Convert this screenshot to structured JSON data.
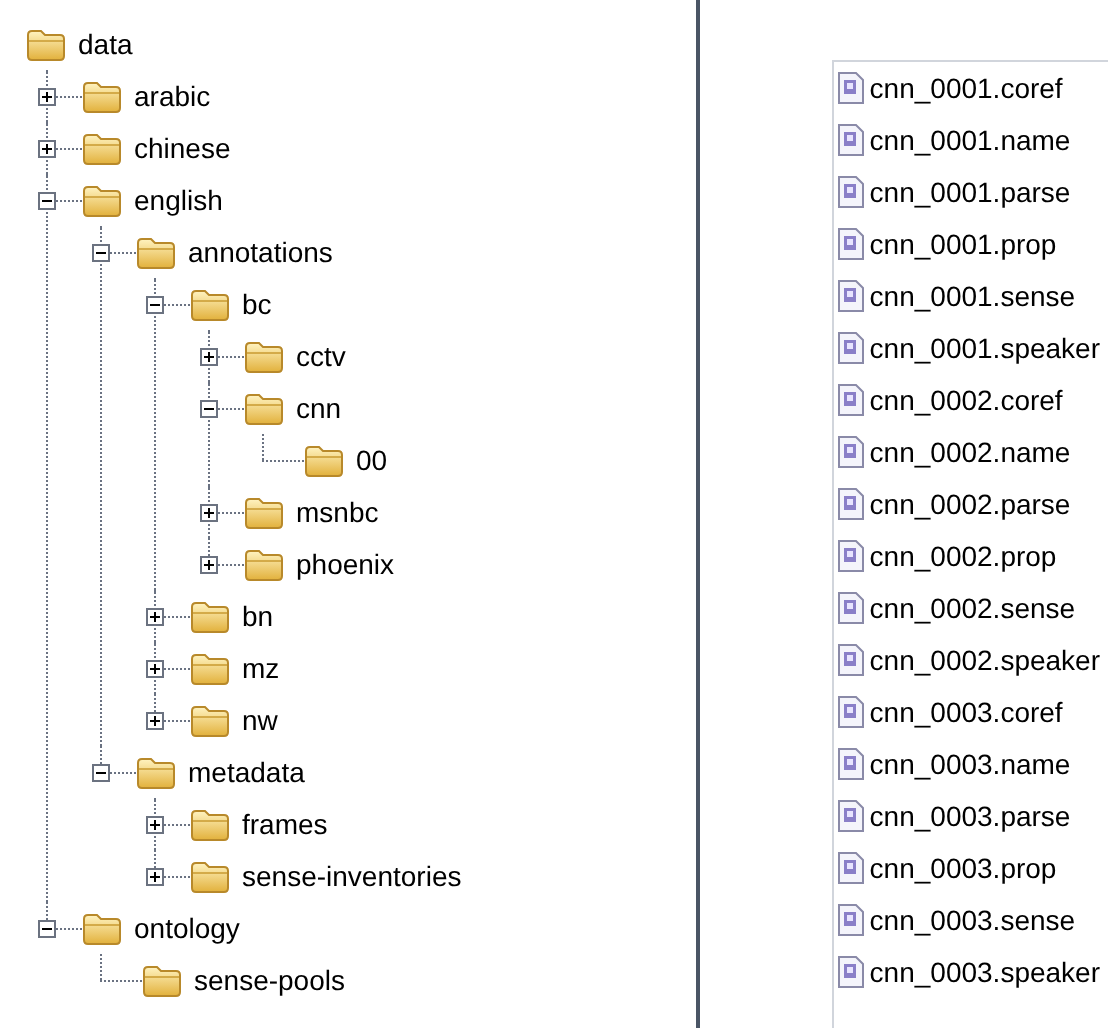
{
  "tree": {
    "label": "data",
    "children": [
      {
        "label": "arabic",
        "expanded": false
      },
      {
        "label": "chinese",
        "expanded": false
      },
      {
        "label": "english",
        "expanded": true,
        "children": [
          {
            "label": "annotations",
            "expanded": true,
            "children": [
              {
                "label": "bc",
                "expanded": true,
                "children": [
                  {
                    "label": "cctv",
                    "expanded": false
                  },
                  {
                    "label": "cnn",
                    "expanded": true,
                    "children": [
                      {
                        "label": "00"
                      }
                    ]
                  },
                  {
                    "label": "msnbc",
                    "expanded": false
                  },
                  {
                    "label": "phoenix",
                    "expanded": false
                  }
                ]
              },
              {
                "label": "bn",
                "expanded": false
              },
              {
                "label": "mz",
                "expanded": false
              },
              {
                "label": "nw",
                "expanded": false
              }
            ]
          },
          {
            "label": "metadata",
            "expanded": true,
            "children": [
              {
                "label": "frames",
                "expanded": false
              },
              {
                "label": "sense-inventories",
                "expanded": false
              }
            ]
          }
        ]
      },
      {
        "label": "ontology",
        "expanded": true,
        "children": [
          {
            "label": "sense-pools"
          }
        ]
      }
    ]
  },
  "files": [
    {
      "name": "cnn_0001.coref"
    },
    {
      "name": "cnn_0001.name"
    },
    {
      "name": "cnn_0001.parse"
    },
    {
      "name": "cnn_0001.prop"
    },
    {
      "name": "cnn_0001.sense"
    },
    {
      "name": "cnn_0001.speaker"
    },
    {
      "name": "cnn_0002.coref"
    },
    {
      "name": "cnn_0002.name"
    },
    {
      "name": "cnn_0002.parse"
    },
    {
      "name": "cnn_0002.prop"
    },
    {
      "name": "cnn_0002.sense"
    },
    {
      "name": "cnn_0002.speaker"
    },
    {
      "name": "cnn_0003.coref"
    },
    {
      "name": "cnn_0003.name"
    },
    {
      "name": "cnn_0003.parse"
    },
    {
      "name": "cnn_0003.prop"
    },
    {
      "name": "cnn_0003.sense"
    },
    {
      "name": "cnn_0003.speaker"
    }
  ]
}
